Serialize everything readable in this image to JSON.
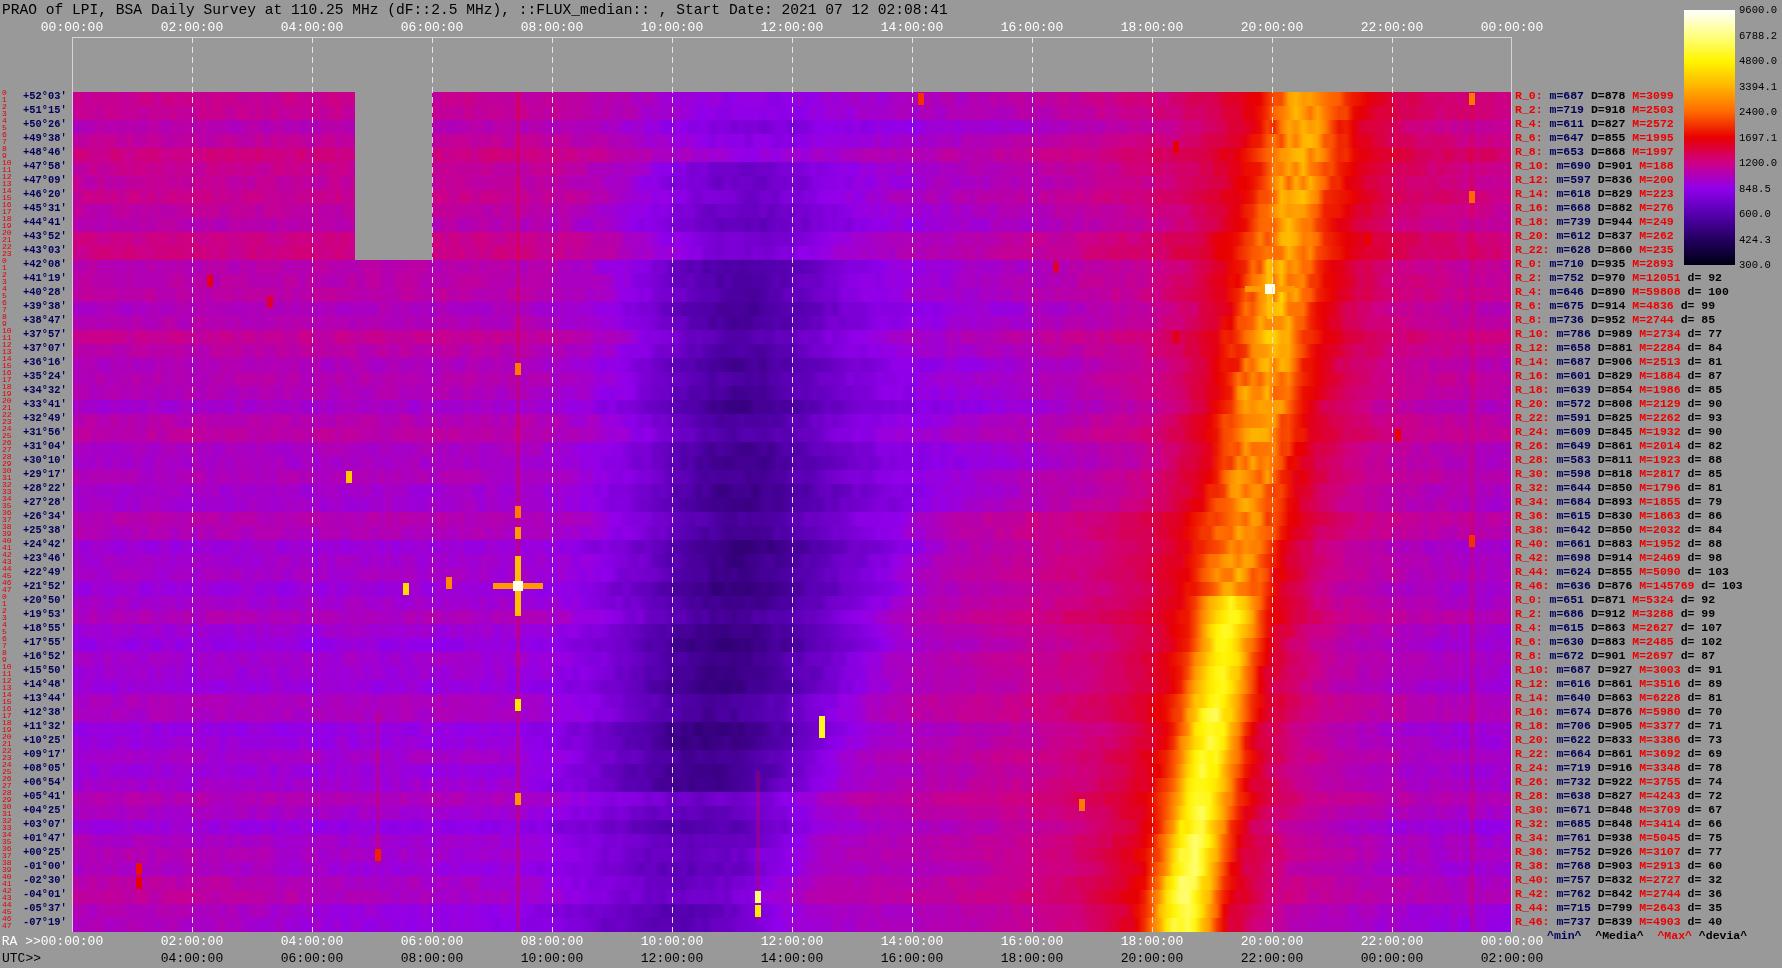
{
  "title": "PRAO of LPI, BSA Daily Survey at 110.25 MHz (dF::2.5 MHz), ::FLUX_median:: , Start Date: 2021 07 12 02:08:41",
  "top_axis": {
    "labels": [
      "00:00:00",
      "02:00:00",
      "04:00:00",
      "06:00:00",
      "08:00:00",
      "10:00:00",
      "12:00:00",
      "14:00:00",
      "16:00:00",
      "18:00:00",
      "20:00:00",
      "22:00:00",
      "00:00:00"
    ]
  },
  "rows": [
    {
      "beams": [
        "0",
        "1"
      ],
      "declination": "+52°03'"
    },
    {
      "beams": [
        "2",
        "3"
      ],
      "declination": "+51°15'"
    },
    {
      "beams": [
        "4",
        "5"
      ],
      "declination": "+50°26'"
    },
    {
      "beams": [
        "6",
        "7"
      ],
      "declination": "+49°38'"
    },
    {
      "beams": [
        "8",
        "9"
      ],
      "declination": "+48°46'"
    },
    {
      "beams": [
        "10",
        "11"
      ],
      "declination": "+47°58'"
    },
    {
      "beams": [
        "12",
        "13"
      ],
      "declination": "+47°09'"
    },
    {
      "beams": [
        "14",
        "15"
      ],
      "declination": "+46°20'"
    },
    {
      "beams": [
        "16",
        "17"
      ],
      "declination": "+45°31'"
    },
    {
      "beams": [
        "18",
        "19"
      ],
      "declination": "+44°41'"
    },
    {
      "beams": [
        "20",
        "21"
      ],
      "declination": "+43°52'"
    },
    {
      "beams": [
        "22",
        "23"
      ],
      "declination": "+43°03'"
    },
    {
      "beams": [
        "0",
        "1"
      ],
      "declination": "+42°08'"
    },
    {
      "beams": [
        "2",
        "3"
      ],
      "declination": "+41°19'"
    },
    {
      "beams": [
        "4",
        "5"
      ],
      "declination": "+40°28'"
    },
    {
      "beams": [
        "6",
        "7"
      ],
      "declination": "+39°38'"
    },
    {
      "beams": [
        "8",
        "9"
      ],
      "declination": "+38°47'"
    },
    {
      "beams": [
        "10",
        "11"
      ],
      "declination": "+37°57'"
    },
    {
      "beams": [
        "12",
        "13"
      ],
      "declination": "+37°07'"
    },
    {
      "beams": [
        "14",
        "15"
      ],
      "declination": "+36°16'"
    },
    {
      "beams": [
        "16",
        "17"
      ],
      "declination": "+35°24'"
    },
    {
      "beams": [
        "18",
        "19"
      ],
      "declination": "+34°32'"
    },
    {
      "beams": [
        "20",
        "21"
      ],
      "declination": "+33°41'"
    },
    {
      "beams": [
        "22",
        "23"
      ],
      "declination": "+32°49'"
    },
    {
      "beams": [
        "24",
        "25"
      ],
      "declination": "+31°56'"
    },
    {
      "beams": [
        "26",
        "27"
      ],
      "declination": "+31°04'"
    },
    {
      "beams": [
        "28",
        "29"
      ],
      "declination": "+30°10'"
    },
    {
      "beams": [
        "30",
        "31"
      ],
      "declination": "+29°17'"
    },
    {
      "beams": [
        "32",
        "33"
      ],
      "declination": "+28°22'"
    },
    {
      "beams": [
        "34",
        "35"
      ],
      "declination": "+27°28'"
    },
    {
      "beams": [
        "36",
        "37"
      ],
      "declination": "+26°34'"
    },
    {
      "beams": [
        "38",
        "39"
      ],
      "declination": "+25°38'"
    },
    {
      "beams": [
        "40",
        "41"
      ],
      "declination": "+24°42'"
    },
    {
      "beams": [
        "42",
        "43"
      ],
      "declination": "+23°46'"
    },
    {
      "beams": [
        "44",
        "45"
      ],
      "declination": "+22°49'"
    },
    {
      "beams": [
        "46",
        "47"
      ],
      "declination": "+21°52'"
    },
    {
      "beams": [
        "0",
        "1"
      ],
      "declination": "+20°50'"
    },
    {
      "beams": [
        "2",
        "3"
      ],
      "declination": "+19°53'"
    },
    {
      "beams": [
        "4",
        "5"
      ],
      "declination": "+18°55'"
    },
    {
      "beams": [
        "6",
        "7"
      ],
      "declination": "+17°55'"
    },
    {
      "beams": [
        "8",
        "9"
      ],
      "declination": "+16°52'"
    },
    {
      "beams": [
        "10",
        "11"
      ],
      "declination": "+15°50'"
    },
    {
      "beams": [
        "12",
        "13"
      ],
      "declination": "+14°48'"
    },
    {
      "beams": [
        "14",
        "15"
      ],
      "declination": "+13°44'"
    },
    {
      "beams": [
        "16",
        "17"
      ],
      "declination": "+12°38'"
    },
    {
      "beams": [
        "18",
        "19"
      ],
      "declination": "+11°32'"
    },
    {
      "beams": [
        "20",
        "21"
      ],
      "declination": "+10°25'"
    },
    {
      "beams": [
        "22",
        "23"
      ],
      "declination": "+09°17'"
    },
    {
      "beams": [
        "24",
        "25"
      ],
      "declination": "+08°05'"
    },
    {
      "beams": [
        "26",
        "27"
      ],
      "declination": "+06°54'"
    },
    {
      "beams": [
        "28",
        "29"
      ],
      "declination": "+05°41'"
    },
    {
      "beams": [
        "30",
        "31"
      ],
      "declination": "+04°25'"
    },
    {
      "beams": [
        "32",
        "33"
      ],
      "declination": "+03°07'"
    },
    {
      "beams": [
        "34",
        "35"
      ],
      "declination": "+01°47'"
    },
    {
      "beams": [
        "36",
        "37"
      ],
      "declination": "+00°25'"
    },
    {
      "beams": [
        "38",
        "39"
      ],
      "declination": "-01°00'"
    },
    {
      "beams": [
        "40",
        "41"
      ],
      "declination": "-02°30'"
    },
    {
      "beams": [
        "42",
        "43"
      ],
      "declination": "-04°01'"
    },
    {
      "beams": [
        "44",
        "45"
      ],
      "declination": "-05°37'"
    },
    {
      "beams": [
        "46",
        "47"
      ],
      "declination": "-07°19'"
    }
  ],
  "ray_stats": [
    {
      "ray": "R_0:",
      "min": "m=687",
      "median": "D=878",
      "max": "M=3099"
    },
    {
      "ray": "R_2:",
      "min": "m=719",
      "median": "D=918",
      "max": "M=2503"
    },
    {
      "ray": "R_4:",
      "min": "m=611",
      "median": "D=827",
      "max": "M=2572"
    },
    {
      "ray": "R_6:",
      "min": "m=647",
      "median": "D=855",
      "max": "M=1995"
    },
    {
      "ray": "R_8:",
      "min": "m=653",
      "median": "D=868",
      "max": "M=1997"
    },
    {
      "ray": "R_10:",
      "min": "m=690",
      "median": "D=901",
      "max": "M=188"
    },
    {
      "ray": "R_12:",
      "min": "m=597",
      "median": "D=836",
      "max": "M=200"
    },
    {
      "ray": "R_14:",
      "min": "m=618",
      "median": "D=829",
      "max": "M=223"
    },
    {
      "ray": "R_16:",
      "min": "m=668",
      "median": "D=882",
      "max": "M=276"
    },
    {
      "ray": "R_18:",
      "min": "m=739",
      "median": "D=944",
      "max": "M=249"
    },
    {
      "ray": "R_20:",
      "min": "m=612",
      "median": "D=837",
      "max": "M=262"
    },
    {
      "ray": "R_22:",
      "min": "m=628",
      "median": "D=860",
      "max": "M=235"
    },
    {
      "ray": "R_0:",
      "min": "m=710",
      "median": "D=935",
      "max": "M=2893"
    },
    {
      "ray": "R_2:",
      "min": "m=752",
      "median": "D=970",
      "max": "M=12051",
      "deviation": "d= 92"
    },
    {
      "ray": "R_4:",
      "min": "m=646",
      "median": "D=890",
      "max": "M=59808",
      "deviation": "d= 100"
    },
    {
      "ray": "R_6:",
      "min": "m=675",
      "median": "D=914",
      "max": "M=4836",
      "deviation": "d= 99"
    },
    {
      "ray": "R_8:",
      "min": "m=736",
      "median": "D=952",
      "max": "M=2744",
      "deviation": "d= 85"
    },
    {
      "ray": "R_10:",
      "min": "m=786",
      "median": "D=989",
      "max": "M=2734",
      "deviation": "d= 77"
    },
    {
      "ray": "R_12:",
      "min": "m=658",
      "median": "D=881",
      "max": "M=2284",
      "deviation": "d= 84"
    },
    {
      "ray": "R_14:",
      "min": "m=687",
      "median": "D=906",
      "max": "M=2513",
      "deviation": "d= 81"
    },
    {
      "ray": "R_16:",
      "min": "m=601",
      "median": "D=829",
      "max": "M=1884",
      "deviation": "d= 87"
    },
    {
      "ray": "R_18:",
      "min": "m=639",
      "median": "D=854",
      "max": "M=1986",
      "deviation": "d= 85"
    },
    {
      "ray": "R_20:",
      "min": "m=572",
      "median": "D=808",
      "max": "M=2129",
      "deviation": "d= 90"
    },
    {
      "ray": "R_22:",
      "min": "m=591",
      "median": "D=825",
      "max": "M=2262",
      "deviation": "d= 93"
    },
    {
      "ray": "R_24:",
      "min": "m=609",
      "median": "D=845",
      "max": "M=1932",
      "deviation": "d= 90"
    },
    {
      "ray": "R_26:",
      "min": "m=649",
      "median": "D=861",
      "max": "M=2014",
      "deviation": "d= 82"
    },
    {
      "ray": "R_28:",
      "min": "m=583",
      "median": "D=811",
      "max": "M=1923",
      "deviation": "d= 88"
    },
    {
      "ray": "R_30:",
      "min": "m=598",
      "median": "D=818",
      "max": "M=2817",
      "deviation": "d= 85"
    },
    {
      "ray": "R_32:",
      "min": "m=644",
      "median": "D=850",
      "max": "M=1796",
      "deviation": "d= 81"
    },
    {
      "ray": "R_34:",
      "min": "m=684",
      "median": "D=893",
      "max": "M=1855",
      "deviation": "d= 79"
    },
    {
      "ray": "R_36:",
      "min": "m=615",
      "median": "D=830",
      "max": "M=1863",
      "deviation": "d= 86"
    },
    {
      "ray": "R_38:",
      "min": "m=642",
      "median": "D=850",
      "max": "M=2032",
      "deviation": "d= 84"
    },
    {
      "ray": "R_40:",
      "min": "m=661",
      "median": "D=883",
      "max": "M=1952",
      "deviation": "d= 88"
    },
    {
      "ray": "R_42:",
      "min": "m=698",
      "median": "D=914",
      "max": "M=2469",
      "deviation": "d= 98"
    },
    {
      "ray": "R_44:",
      "min": "m=624",
      "median": "D=855",
      "max": "M=5090",
      "deviation": "d= 103"
    },
    {
      "ray": "R_46:",
      "min": "m=636",
      "median": "D=876",
      "max": "M=145769",
      "deviation": "d= 103"
    },
    {
      "ray": "R_0:",
      "min": "m=651",
      "median": "D=871",
      "max": "M=5324",
      "deviation": "d= 92"
    },
    {
      "ray": "R_2:",
      "min": "m=686",
      "median": "D=912",
      "max": "M=3288",
      "deviation": "d= 99"
    },
    {
      "ray": "R_4:",
      "min": "m=615",
      "median": "D=863",
      "max": "M=2627",
      "deviation": "d= 107"
    },
    {
      "ray": "R_6:",
      "min": "m=630",
      "median": "D=883",
      "max": "M=2485",
      "deviation": "d= 102"
    },
    {
      "ray": "R_8:",
      "min": "m=672",
      "median": "D=901",
      "max": "M=2697",
      "deviation": "d= 87"
    },
    {
      "ray": "R_10:",
      "min": "m=687",
      "median": "D=927",
      "max": "M=3003",
      "deviation": "d= 91"
    },
    {
      "ray": "R_12:",
      "min": "m=616",
      "median": "D=861",
      "max": "M=3516",
      "deviation": "d= 89"
    },
    {
      "ray": "R_14:",
      "min": "m=640",
      "median": "D=863",
      "max": "M=6228",
      "deviation": "d= 81"
    },
    {
      "ray": "R_16:",
      "min": "m=674",
      "median": "D=876",
      "max": "M=5980",
      "deviation": "d= 70"
    },
    {
      "ray": "R_18:",
      "min": "m=706",
      "median": "D=905",
      "max": "M=3377",
      "deviation": "d= 71"
    },
    {
      "ray": "R_20:",
      "min": "m=622",
      "median": "D=833",
      "max": "M=3386",
      "deviation": "d= 73"
    },
    {
      "ray": "R_22:",
      "min": "m=664",
      "median": "D=861",
      "max": "M=3692",
      "deviation": "d= 69"
    },
    {
      "ray": "R_24:",
      "min": "m=719",
      "median": "D=916",
      "max": "M=3348",
      "deviation": "d= 78"
    },
    {
      "ray": "R_26:",
      "min": "m=732",
      "median": "D=922",
      "max": "M=3755",
      "deviation": "d= 74"
    },
    {
      "ray": "R_28:",
      "min": "m=638",
      "median": "D=827",
      "max": "M=4243",
      "deviation": "d= 72"
    },
    {
      "ray": "R_30:",
      "min": "m=671",
      "median": "D=848",
      "max": "M=3709",
      "deviation": "d= 67"
    },
    {
      "ray": "R_32:",
      "min": "m=685",
      "median": "D=848",
      "max": "M=3414",
      "deviation": "d= 66"
    },
    {
      "ray": "R_34:",
      "min": "m=761",
      "median": "D=938",
      "max": "M=5045",
      "deviation": "d= 75"
    },
    {
      "ray": "R_36:",
      "min": "m=752",
      "median": "D=926",
      "max": "M=3107",
      "deviation": "d= 77"
    },
    {
      "ray": "R_38:",
      "min": "m=768",
      "median": "D=903",
      "max": "M=2913",
      "deviation": "d= 60"
    },
    {
      "ray": "R_40:",
      "min": "m=757",
      "median": "D=832",
      "max": "M=2727",
      "deviation": "d= 32"
    },
    {
      "ray": "R_42:",
      "min": "m=762",
      "median": "D=842",
      "max": "M=2744",
      "deviation": "d= 36"
    },
    {
      "ray": "R_44:",
      "min": "m=715",
      "median": "D=799",
      "max": "M=2643",
      "deviation": "d= 35"
    },
    {
      "ray": "R_46:",
      "min": "m=737",
      "median": "D=839",
      "max": "M=4903",
      "deviation": "d= 40"
    }
  ],
  "stats_legend": [
    {
      "kind": "min",
      "label": "^min^"
    },
    {
      "kind": "median",
      "label": "^Media^"
    },
    {
      "kind": "max",
      "label": "^Max^"
    },
    {
      "kind": "deviation",
      "label": "^devia^"
    }
  ],
  "color_scale": {
    "ticks": [
      "9600.0",
      "6788.2",
      "4800.0",
      "3394.1",
      "2400.0",
      "1697.1",
      "1200.0",
      "848.5",
      "600.0",
      "424.3",
      "300.0"
    ]
  },
  "ra_axis": {
    "prefix": "RA >>",
    "labels": [
      "00:00:00",
      "02:00:00",
      "04:00:00",
      "06:00:00",
      "08:00:00",
      "10:00:00",
      "12:00:00",
      "14:00:00",
      "16:00:00",
      "18:00:00",
      "20:00:00",
      "22:00:00",
      "00:00:00"
    ]
  },
  "utc_axis": {
    "prefix": "UTC>>",
    "labels": [
      "04:00:00",
      "06:00:00",
      "08:00:00",
      "10:00:00",
      "12:00:00",
      "14:00:00",
      "16:00:00",
      "18:00:00",
      "20:00:00",
      "22:00:00",
      "00:00:00",
      "02:00:00"
    ]
  }
}
